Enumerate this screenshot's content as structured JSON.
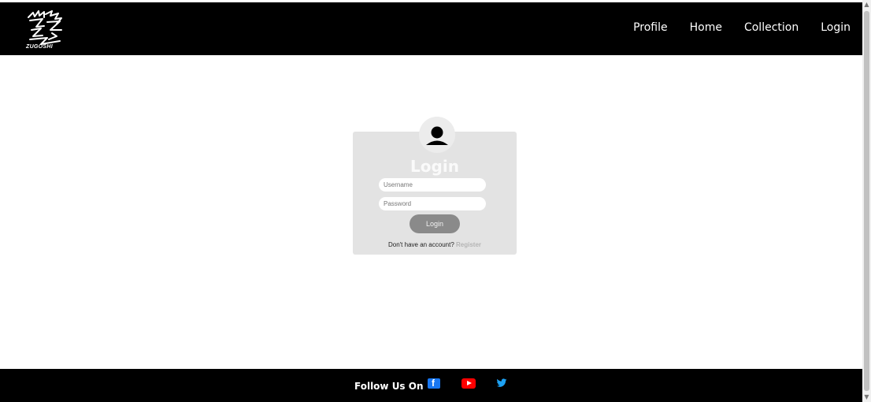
{
  "brand": {
    "logo_text": "ZUGOSHI"
  },
  "nav": {
    "items": [
      {
        "label": "Profile"
      },
      {
        "label": "Home"
      },
      {
        "label": "Collection"
      },
      {
        "label": "Login"
      }
    ]
  },
  "login_form": {
    "title": "Login",
    "username_placeholder": "Username",
    "password_placeholder": "Password",
    "submit_label": "Login",
    "register_prompt": "Don't have an account?",
    "register_link": "Register"
  },
  "footer": {
    "follow_text": "Follow Us On",
    "social_icons": [
      "facebook-icon",
      "youtube-icon",
      "twitter-icon"
    ]
  },
  "colors": {
    "header_bg": "#000000",
    "card_bg": "#e3e3e3",
    "button_bg": "#8a8a8a",
    "facebook": "#1877f2",
    "youtube": "#ff0000",
    "twitter": "#1da1f2"
  }
}
